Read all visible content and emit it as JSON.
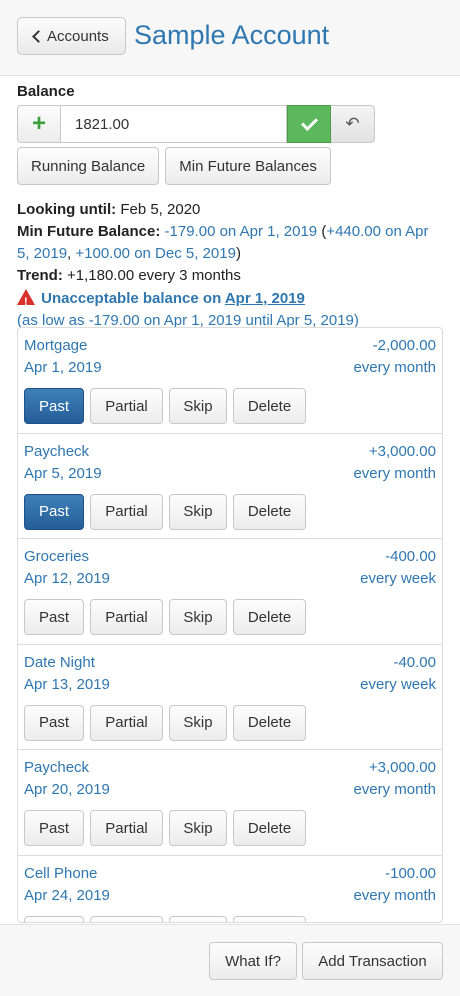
{
  "header": {
    "back_label": "Accounts",
    "title": "Sample Account"
  },
  "balance": {
    "label": "Balance",
    "value": "1821.00",
    "buttons": {
      "running": "Running Balance",
      "min_future": "Min Future Balances"
    }
  },
  "info": {
    "looking_until_label": "Looking until:",
    "looking_until_value": "Feb 5, 2020",
    "min_future_label": "Min Future Balance:",
    "min_future_value": "-179.00 on Apr 1, 2019",
    "min_future_paren_open": " (",
    "min_future_extra_1": "+440.00 on Apr 5, 2019",
    "min_future_sep": ", ",
    "min_future_extra_2": "+100.00 on Dec 5, 2019",
    "min_future_paren_close": ")",
    "trend_label": "Trend:",
    "trend_value": "+1,180.00 every 3 months",
    "warning_text": "Unacceptable balance on ",
    "warning_date": "Apr 1, 2019",
    "warning_detail": "(as low as -179.00 on Apr 1, 2019 until Apr 5, 2019)"
  },
  "action_labels": {
    "past": "Past",
    "partial": "Partial",
    "skip": "Skip",
    "delete": "Delete"
  },
  "transactions": [
    {
      "name": "Mortgage",
      "amount": "-2,000.00",
      "date": "Apr 1, 2019",
      "frequency": "every month",
      "past_active": true
    },
    {
      "name": "Paycheck",
      "amount": "+3,000.00",
      "date": "Apr 5, 2019",
      "frequency": "every month",
      "past_active": true
    },
    {
      "name": "Groceries",
      "amount": "-400.00",
      "date": "Apr 12, 2019",
      "frequency": "every week",
      "past_active": false
    },
    {
      "name": "Date Night",
      "amount": "-40.00",
      "date": "Apr 13, 2019",
      "frequency": "every week",
      "past_active": false
    },
    {
      "name": "Paycheck",
      "amount": "+3,000.00",
      "date": "Apr 20, 2019",
      "frequency": "every month",
      "past_active": false
    },
    {
      "name": "Cell Phone",
      "amount": "-100.00",
      "date": "Apr 24, 2019",
      "frequency": "every month",
      "past_active": false
    }
  ],
  "footer": {
    "what_if": "What If?",
    "add_transaction": "Add Transaction"
  },
  "colors": {
    "link_blue": "#2f77b0",
    "active_button": "#2d6aa6",
    "confirm_green": "#5cb85c",
    "warning_red": "#d9302c"
  }
}
